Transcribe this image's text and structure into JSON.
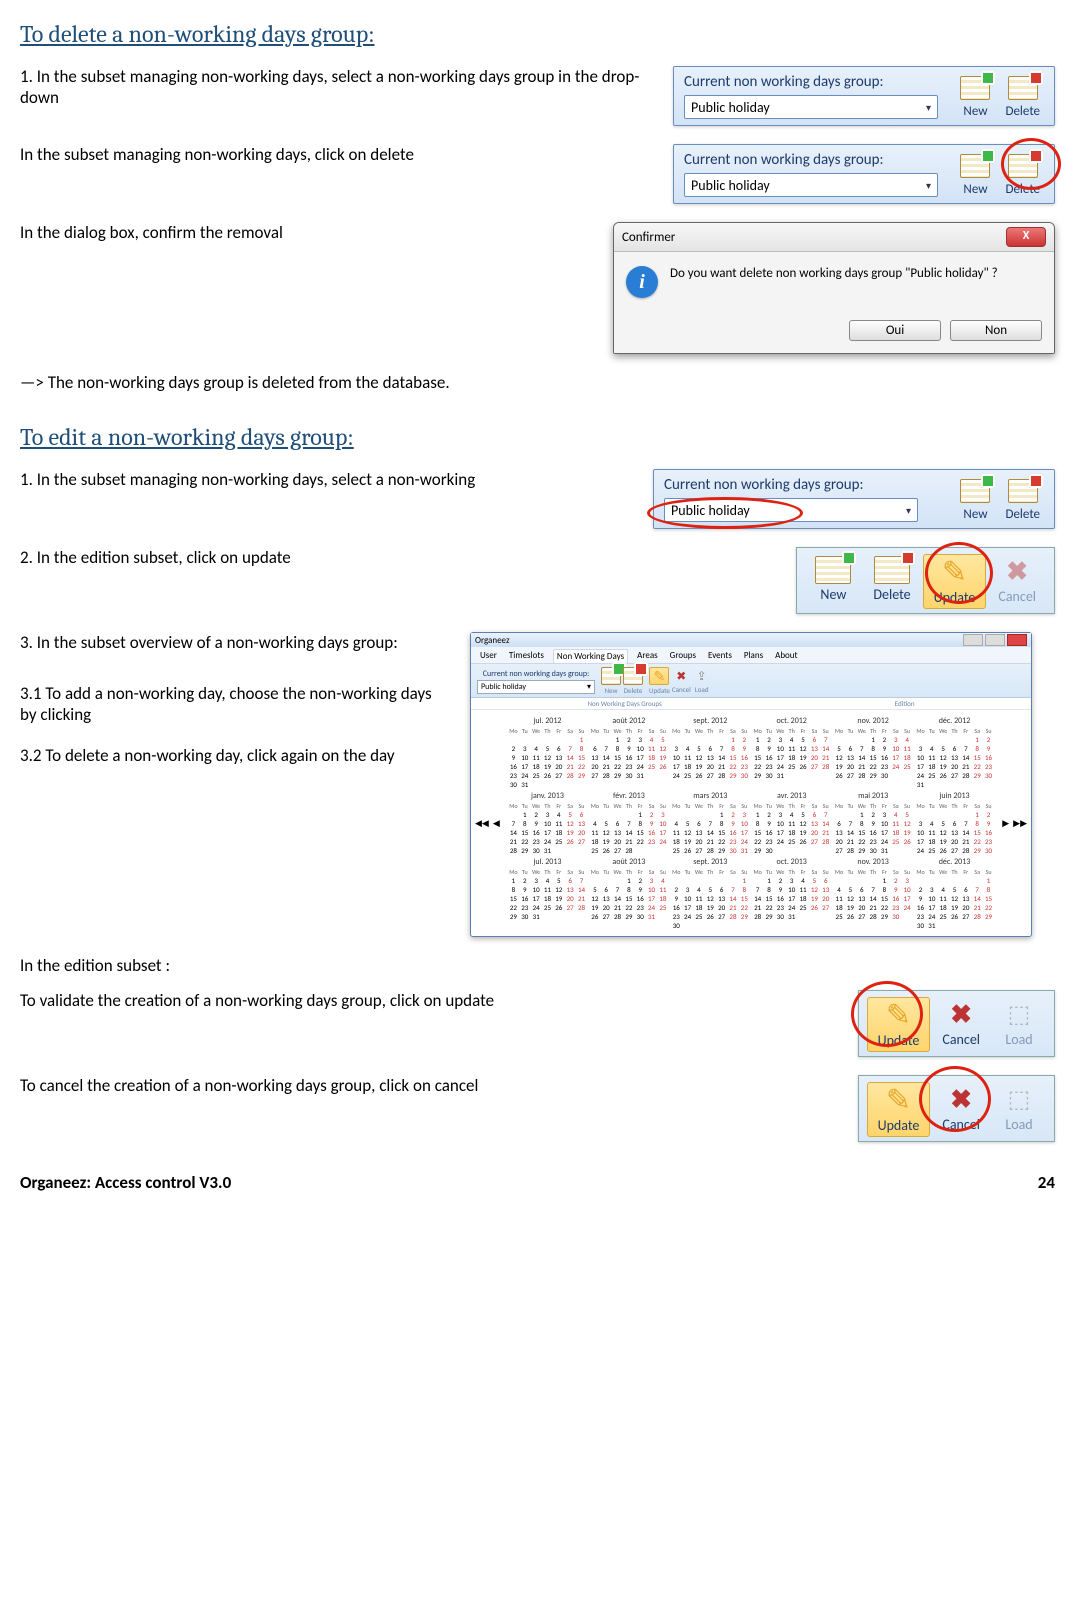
{
  "sect1_title": "To delete a non-working days group:",
  "step1": "1. In the subset managing non-working days, select a non-working days group in the drop-down",
  "step1b": "In the subset managing non-working days, click on delete",
  "step1c": "In the dialog box, confirm the removal",
  "step1d": "—> The non-working days group is deleted from the database.",
  "ribbon_label": "Current non working days group:",
  "dropdown_value": "Public holiday",
  "btn_new": "New",
  "btn_delete": "Delete",
  "btn_update": "Update",
  "btn_cancel": "Cancel",
  "btn_load": "Load",
  "dialog_title": "Confirmer",
  "dialog_msg": "Do you want delete non working days group \"Public holiday\" ?",
  "dialog_yes": "Oui",
  "dialog_no": "Non",
  "sect2_title": "To edit a non-working days group:",
  "step2_1": "1.  In the subset managing non-working days, select a non-working",
  "step2_2": "2.  In the edition subset, click on update",
  "step2_3": "3. In the subset overview of a non-working days group:",
  "step2_31": "3.1  To add a non-working day, choose the non-working days by clicking",
  "step2_32": "3.2 To delete a non-working day, click again on the day",
  "step2_edit": "In the edition subset :",
  "step2_validate": "To validate the creation of a non-working days group, click on update",
  "step2_cancel": "To cancel the creation of a non-working days group, click on cancel",
  "app_title": "Organeez",
  "app_tabs": [
    "User",
    "Timeslots",
    "Non Working Days",
    "Areas",
    "Groups",
    "Events",
    "Plans",
    "About"
  ],
  "app_group1": "Non Working Days Groups",
  "app_group2": "Edition",
  "dow": [
    "Mo",
    "Tu",
    "We",
    "Th",
    "Fr",
    "Sa",
    "Su"
  ],
  "months": [
    "jul. 2012",
    "août 2012",
    "sept. 2012",
    "oct. 2012",
    "nov. 2012",
    "déc. 2012",
    "janv. 2013",
    "févr. 2013",
    "mars 2013",
    "avr. 2013",
    "mai 2013",
    "juin 2013",
    "jul. 2013",
    "août 2013",
    "sept. 2013",
    "oct. 2013",
    "nov. 2013",
    "déc. 2013"
  ],
  "footer_left": "Organeez: Access control    V3.0",
  "footer_right": "24"
}
